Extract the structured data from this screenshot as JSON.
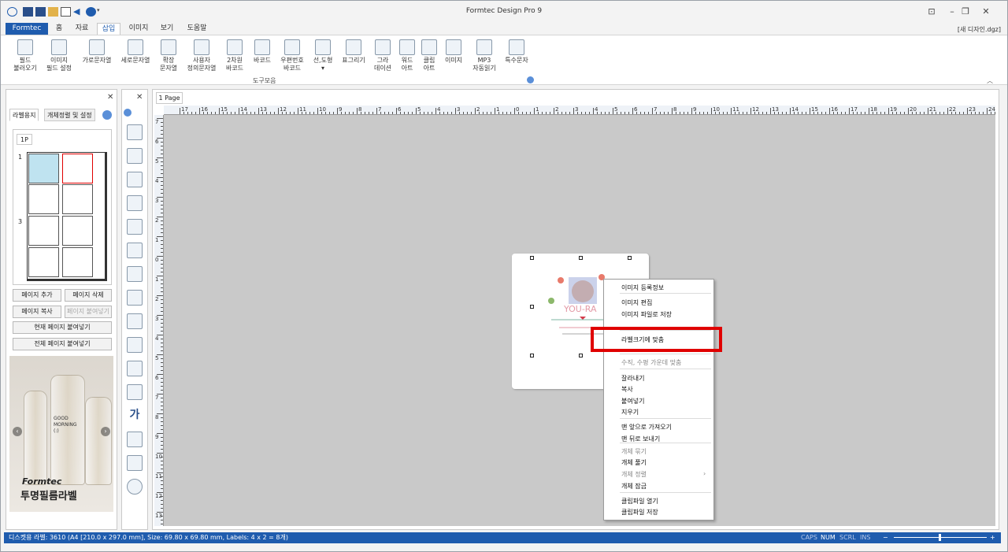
{
  "app": {
    "title": "Formtec Design Pro 9",
    "filename": "[새 디자인.dgz]"
  },
  "tabs": [
    "Formtec",
    "홈",
    "자료",
    "삽입",
    "이미지",
    "보기",
    "도움말"
  ],
  "ribbon": {
    "buttons": [
      "필드\n불러오기",
      "이미지\n필드 설정",
      "가로문자열",
      "세로문자열",
      "확장\n문자열",
      "사용자\n정의문자열",
      "2차원\n바코드",
      "바코드",
      "우편번호\n바코드",
      "선,도형\n▾",
      "표그리기",
      "그라\n데이션",
      "워드\n아트",
      "클립\n아트",
      "이미지",
      "MP3\n자동읽기",
      "특수문자"
    ],
    "group_label": "도구모음"
  },
  "left_panel": {
    "tabs": [
      "라벨용지",
      "개체정렬 및 설정"
    ],
    "sheet_tab": "1P",
    "row_numbers": [
      "1",
      "3"
    ],
    "buttons": {
      "add_page": "페이지 추가",
      "delete_page": "페이지 삭제",
      "copy_page": "페이지 복사",
      "paste_page": "페이지 붙여넣기",
      "paste_current": "현재 페이지 붙여넣기",
      "paste_all": "전체 페이지 붙여넣기"
    },
    "ad": {
      "brand": "Formtec",
      "text": "투명필름라벨",
      "bottle_text": "GOOD\nMORNING\n(:)"
    }
  },
  "canvas": {
    "page_tab": "1 Page",
    "hruler_labels": [
      "17",
      "16",
      "15",
      "14",
      "13",
      "12",
      "11",
      "10",
      "9",
      "8",
      "7",
      "6",
      "5",
      "4",
      "3",
      "2",
      "1",
      "0",
      "1",
      "2",
      "3",
      "4",
      "5",
      "6",
      "7",
      "8",
      "9",
      "10",
      "11",
      "12",
      "13",
      "14",
      "15",
      "16",
      "17",
      "18",
      "19",
      "20",
      "21",
      "22",
      "23",
      "24"
    ],
    "vruler_labels": [
      "7",
      "6",
      "5",
      "4",
      "3",
      "2",
      "1",
      "0",
      "1",
      "2",
      "3",
      "4",
      "5",
      "6",
      "7",
      "8",
      "9",
      "10",
      "11",
      "12",
      "13"
    ],
    "label_art_text": "YOU-RA"
  },
  "context_menu": {
    "items": [
      {
        "label": "이미지 등록정보",
        "disabled": false
      },
      {
        "label": "이미지 편집",
        "disabled": false
      },
      {
        "label": "이미지 파일로 저장",
        "disabled": false
      },
      {
        "label": "라벨크기에 맞춤",
        "disabled": false,
        "highlighted": true
      },
      {
        "label": "수직, 수평 가운데 맞춤",
        "disabled": true
      },
      {
        "label": "잘라내기",
        "disabled": false
      },
      {
        "label": "복사",
        "disabled": false
      },
      {
        "label": "붙여넣기",
        "disabled": false
      },
      {
        "label": "지우기",
        "disabled": false
      },
      {
        "label": "맨 앞으로 가져오기",
        "disabled": false
      },
      {
        "label": "맨 뒤로 보내기",
        "disabled": false
      },
      {
        "label": "개체 묶기",
        "disabled": true
      },
      {
        "label": "개체 풀기",
        "disabled": false
      },
      {
        "label": "개체 정렬",
        "disabled": true,
        "submenu": true
      },
      {
        "label": "개체 잠금",
        "disabled": false
      },
      {
        "label": "클립파일 열기",
        "disabled": false
      },
      {
        "label": "클립파일 저장",
        "disabled": false
      }
    ]
  },
  "status": {
    "text": "디스켓용 라벨: 3610 (A4 [210.0 x 297.0 mm], Size: 69.80 x 69.80 mm,  Labels: 4 x 2 = 8개)",
    "keys": [
      "CAPS",
      "NUM",
      "SCRL",
      "INS"
    ],
    "active_key": "NUM",
    "zoom_minus": "−",
    "zoom_plus": "+"
  },
  "colors": {
    "accent": "#1f5cae",
    "highlight": "#99c9ef",
    "annotation": "#e00000"
  }
}
